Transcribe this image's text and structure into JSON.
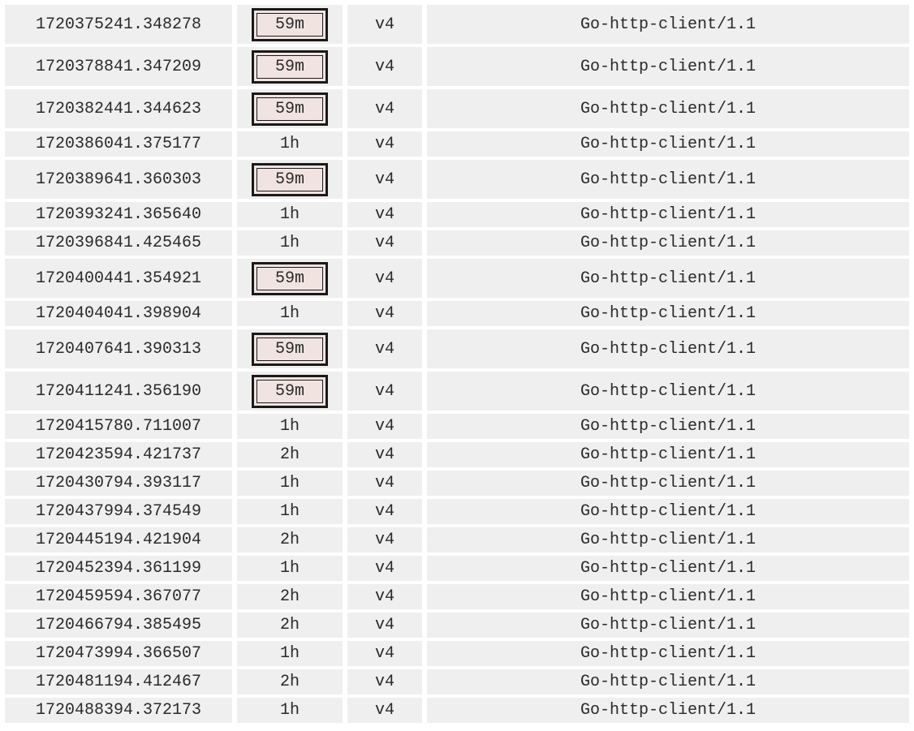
{
  "rows": [
    {
      "timestamp": "1720375241.348278",
      "duration": "59m",
      "highlighted": true,
      "version": "v4",
      "agent": "Go-http-client/1.1"
    },
    {
      "timestamp": "1720378841.347209",
      "duration": "59m",
      "highlighted": true,
      "version": "v4",
      "agent": "Go-http-client/1.1"
    },
    {
      "timestamp": "1720382441.344623",
      "duration": "59m",
      "highlighted": true,
      "version": "v4",
      "agent": "Go-http-client/1.1"
    },
    {
      "timestamp": "1720386041.375177",
      "duration": "1h",
      "highlighted": false,
      "version": "v4",
      "agent": "Go-http-client/1.1"
    },
    {
      "timestamp": "1720389641.360303",
      "duration": "59m",
      "highlighted": true,
      "version": "v4",
      "agent": "Go-http-client/1.1"
    },
    {
      "timestamp": "1720393241.365640",
      "duration": "1h",
      "highlighted": false,
      "version": "v4",
      "agent": "Go-http-client/1.1"
    },
    {
      "timestamp": "1720396841.425465",
      "duration": "1h",
      "highlighted": false,
      "version": "v4",
      "agent": "Go-http-client/1.1"
    },
    {
      "timestamp": "1720400441.354921",
      "duration": "59m",
      "highlighted": true,
      "version": "v4",
      "agent": "Go-http-client/1.1"
    },
    {
      "timestamp": "1720404041.398904",
      "duration": "1h",
      "highlighted": false,
      "version": "v4",
      "agent": "Go-http-client/1.1"
    },
    {
      "timestamp": "1720407641.390313",
      "duration": "59m",
      "highlighted": true,
      "version": "v4",
      "agent": "Go-http-client/1.1"
    },
    {
      "timestamp": "1720411241.356190",
      "duration": "59m",
      "highlighted": true,
      "version": "v4",
      "agent": "Go-http-client/1.1"
    },
    {
      "timestamp": "1720415780.711007",
      "duration": "1h",
      "highlighted": false,
      "version": "v4",
      "agent": "Go-http-client/1.1"
    },
    {
      "timestamp": "1720423594.421737",
      "duration": "2h",
      "highlighted": false,
      "version": "v4",
      "agent": "Go-http-client/1.1"
    },
    {
      "timestamp": "1720430794.393117",
      "duration": "1h",
      "highlighted": false,
      "version": "v4",
      "agent": "Go-http-client/1.1"
    },
    {
      "timestamp": "1720437994.374549",
      "duration": "1h",
      "highlighted": false,
      "version": "v4",
      "agent": "Go-http-client/1.1"
    },
    {
      "timestamp": "1720445194.421904",
      "duration": "2h",
      "highlighted": false,
      "version": "v4",
      "agent": "Go-http-client/1.1"
    },
    {
      "timestamp": "1720452394.361199",
      "duration": "1h",
      "highlighted": false,
      "version": "v4",
      "agent": "Go-http-client/1.1"
    },
    {
      "timestamp": "1720459594.367077",
      "duration": "2h",
      "highlighted": false,
      "version": "v4",
      "agent": "Go-http-client/1.1"
    },
    {
      "timestamp": "1720466794.385495",
      "duration": "2h",
      "highlighted": false,
      "version": "v4",
      "agent": "Go-http-client/1.1"
    },
    {
      "timestamp": "1720473994.366507",
      "duration": "1h",
      "highlighted": false,
      "version": "v4",
      "agent": "Go-http-client/1.1"
    },
    {
      "timestamp": "1720481194.412467",
      "duration": "2h",
      "highlighted": false,
      "version": "v4",
      "agent": "Go-http-client/1.1"
    },
    {
      "timestamp": "1720488394.372173",
      "duration": "1h",
      "highlighted": false,
      "version": "v4",
      "agent": "Go-http-client/1.1"
    }
  ]
}
